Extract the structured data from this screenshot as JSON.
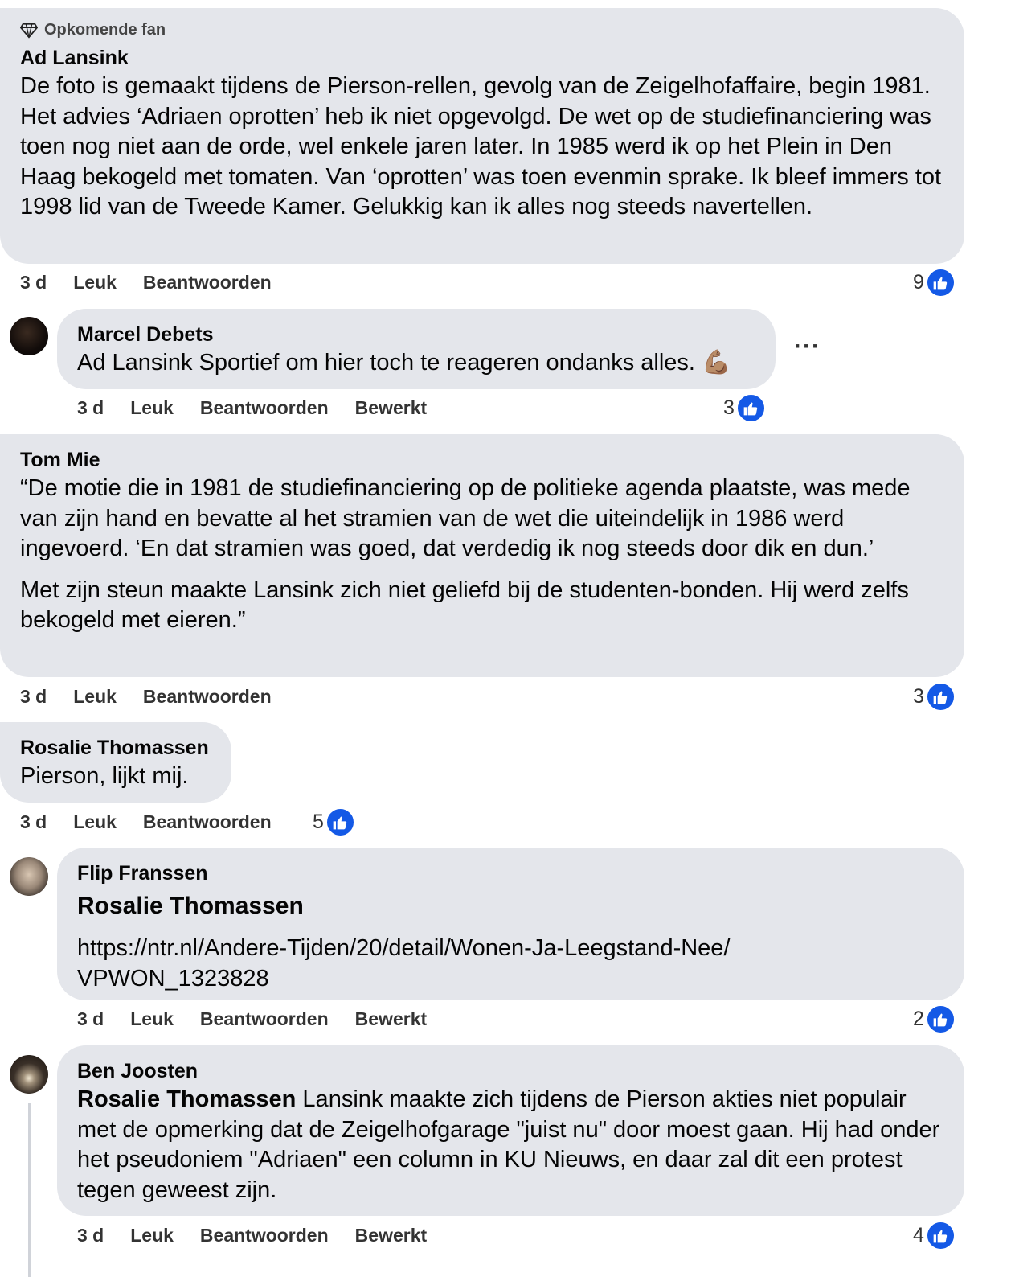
{
  "comments": [
    {
      "badge": "Opkomende fan",
      "author": "Ad Lansink",
      "text": "De foto is gemaakt tijdens de Pierson-rellen, gevolg van de Zeigelhofaffaire, begin 1981. Het advies ‘Adriaen oprotten’ heb ik niet opgevolgd. De wet op de studiefinanciering was toen nog niet aan de orde, wel enkele jaren later. In 1985 werd ik op het Plein in Den Haag bekogeld met tomaten. Van ‘oprotten’ was toen evenmin sprake. Ik bleef immers tot 1998 lid van de Tweede Kamer. Gelukkig kan ik alles nog steeds navertellen.",
      "time": "3 d",
      "like": "Leuk",
      "reply": "Beantwoorden",
      "likes": "9"
    },
    {
      "author": "Marcel Debets",
      "text": "Ad Lansink Sportief om hier toch te reageren ondanks alles. 💪🏽",
      "more": "···",
      "time": "3 d",
      "like": "Leuk",
      "reply": "Beantwoorden",
      "edited": "Bewerkt",
      "likes": "3"
    },
    {
      "author": "Tom Mie",
      "paragraph1": "“De motie die in 1981 de studiefinanciering op de politieke agenda plaatste, was mede van zijn hand en bevatte al het stramien van de wet die uiteindelijk in 1986 werd ingevoerd. ‘En dat stramien was goed, dat verdedig ik nog steeds door dik en dun.’",
      "paragraph2": "Met zijn steun maakte Lansink zich niet geliefd bij de studenten-bonden. Hij werd zelfs bekogeld met eieren.”",
      "time": "3 d",
      "like": "Leuk",
      "reply": "Beantwoorden",
      "likes": "3"
    },
    {
      "author": "Rosalie Thomassen",
      "text": "Pierson, lijkt mij.",
      "time": "3 d",
      "like": "Leuk",
      "reply": "Beantwoorden",
      "likes": "5"
    },
    {
      "author": "Flip Franssen",
      "mention": "Rosalie Thomassen",
      "link": "https://ntr.nl/Andere-Tijden/20/detail/Wonen-Ja-Leegstand-Nee/VPWON_1323828",
      "time": "3 d",
      "like": "Leuk",
      "reply": "Beantwoorden",
      "edited": "Bewerkt",
      "likes": "2"
    },
    {
      "author": "Ben Joosten",
      "mention": "Rosalie Thomassen",
      "text": " Lansink maakte zich tijdens de Pierson akties niet populair met de opmerking dat de Zeigelhofgarage \"juist nu\" door moest gaan. Hij had onder het pseudoniem \"Adriaen\" een column in KU Nieuws, en daar zal dit een protest tegen geweest zijn.",
      "time": "3 d",
      "like": "Leuk",
      "reply": "Beantwoorden",
      "edited": "Bewerkt",
      "likes": "4"
    }
  ],
  "colors": {
    "bubble": "#e4e6eb",
    "like_blue": "#1459e6"
  }
}
